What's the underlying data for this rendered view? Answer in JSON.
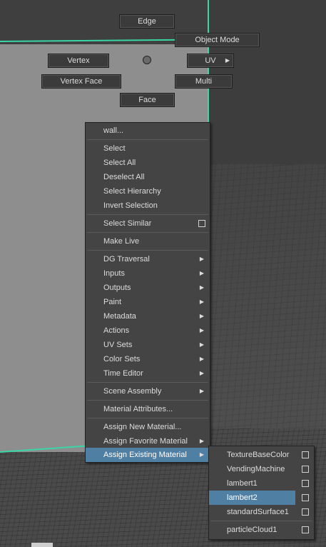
{
  "marking_menu": {
    "top": "Edge",
    "top_right": "Object Mode",
    "left": "Vertex",
    "right": "UV",
    "bottom_left": "Vertex Face",
    "bottom_right": "Multi",
    "bottom": "Face"
  },
  "context_menu": {
    "object_name": "wall...",
    "items": {
      "select": "Select",
      "select_all": "Select All",
      "deselect_all": "Deselect All",
      "select_hierarchy": "Select Hierarchy",
      "invert_selection": "Invert Selection",
      "select_similar": "Select Similar",
      "make_live": "Make Live",
      "dg_traversal": "DG Traversal",
      "inputs": "Inputs",
      "outputs": "Outputs",
      "paint": "Paint",
      "metadata": "Metadata",
      "actions": "Actions",
      "uv_sets": "UV Sets",
      "color_sets": "Color Sets",
      "time_editor": "Time Editor",
      "scene_assembly": "Scene Assembly",
      "material_attributes": "Material Attributes...",
      "assign_new_material": "Assign New Material...",
      "assign_favorite_material": "Assign Favorite Material",
      "assign_existing_material": "Assign Existing Material"
    }
  },
  "materials_submenu": {
    "items": [
      "TextureBaseColor",
      "VendingMachine",
      "lambert1",
      "lambert2",
      "standardSurface1"
    ],
    "extra": "particleCloud1",
    "highlighted": "lambert2"
  },
  "colors": {
    "highlight": "#4f7fa3",
    "wireframe": "#39d6a6"
  }
}
